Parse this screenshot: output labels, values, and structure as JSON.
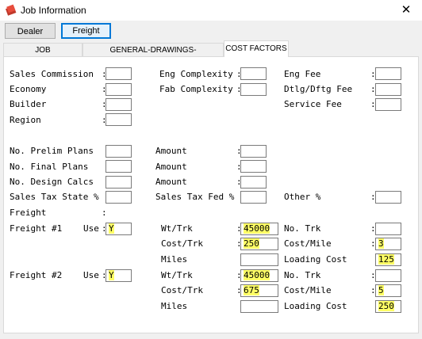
{
  "window": {
    "title": "Job Information",
    "close_glyph": "✕"
  },
  "buttons": {
    "dealer": "Dealer",
    "freight": "Freight"
  },
  "tabs": [
    "JOB IDENTIFICATION",
    "GENERAL-DRAWINGS-CALCULATIONS",
    "COST FACTORS"
  ],
  "labels": {
    "sales_commission": "Sales Commission",
    "economy": "Economy",
    "builder": "Builder",
    "region": "Region",
    "eng_complexity": "Eng Complexity",
    "fab_complexity": "Fab Complexity",
    "eng_fee": "Eng Fee",
    "dtlg_dftg_fee": "Dtlg/Dftg Fee",
    "service_fee": "Service Fee",
    "no_prelim_plans": "No. Prelim Plans",
    "no_final_plans": "No. Final Plans",
    "no_design_calcs": "No. Design Calcs",
    "sales_tax_state": "Sales Tax State %",
    "amount": "Amount",
    "sales_tax_fed": "Sales Tax Fed %",
    "other_pct": "Other %",
    "freight": "Freight",
    "freight1": "Freight #1",
    "freight2": "Freight #2",
    "use": "Use",
    "wt_trk": "Wt/Trk",
    "cost_trk": "Cost/Trk",
    "miles": "Miles",
    "no_trk": "No. Trk",
    "cost_mile": "Cost/Mile",
    "loading_cost": "Loading Cost"
  },
  "values": {
    "freight1_use": "Y",
    "freight1_wt_trk": "45000",
    "freight1_cost_trk": "250",
    "freight1_cost_mile": "3",
    "freight1_loading_cost": "125",
    "freight2_use": "Y",
    "freight2_wt_trk": "45000",
    "freight2_cost_trk": "675",
    "freight2_cost_mile": "5",
    "freight2_loading_cost": "250"
  },
  "colors": {
    "highlight": "#ffff66",
    "focus": "#0078d7"
  }
}
